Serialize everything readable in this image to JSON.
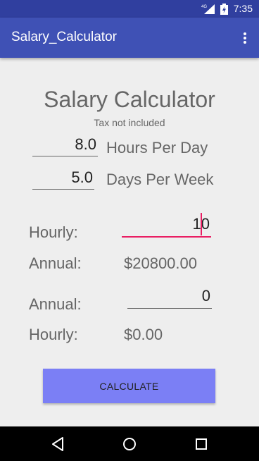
{
  "status": {
    "time": "7:35",
    "network": "4G"
  },
  "toolbar": {
    "title": "Salary_Calculator"
  },
  "main": {
    "heading": "Salary Calculator",
    "subheading": "Tax not included",
    "hours_per_day": {
      "value": "8.0",
      "label": "Hours Per Day"
    },
    "days_per_week": {
      "value": "5.0",
      "label": "Days Per Week"
    },
    "hourly_input": {
      "label": "Hourly:",
      "value": "10"
    },
    "annual_result": {
      "label": "Annual:",
      "value": "$20800.00"
    },
    "annual_input": {
      "label": "Annual:",
      "value": "0"
    },
    "hourly_result": {
      "label": "Hourly:",
      "value": "$0.00"
    },
    "calculate_label": "CALCULATE"
  },
  "colors": {
    "status_bar": "#303f9f",
    "app_bar": "#3f51b5",
    "accent": "#e91e63",
    "button": "#7b7ff5"
  },
  "icons": [
    "signal-icon",
    "battery-icon",
    "overflow-menu-icon",
    "back-icon",
    "home-icon",
    "recents-icon"
  ]
}
